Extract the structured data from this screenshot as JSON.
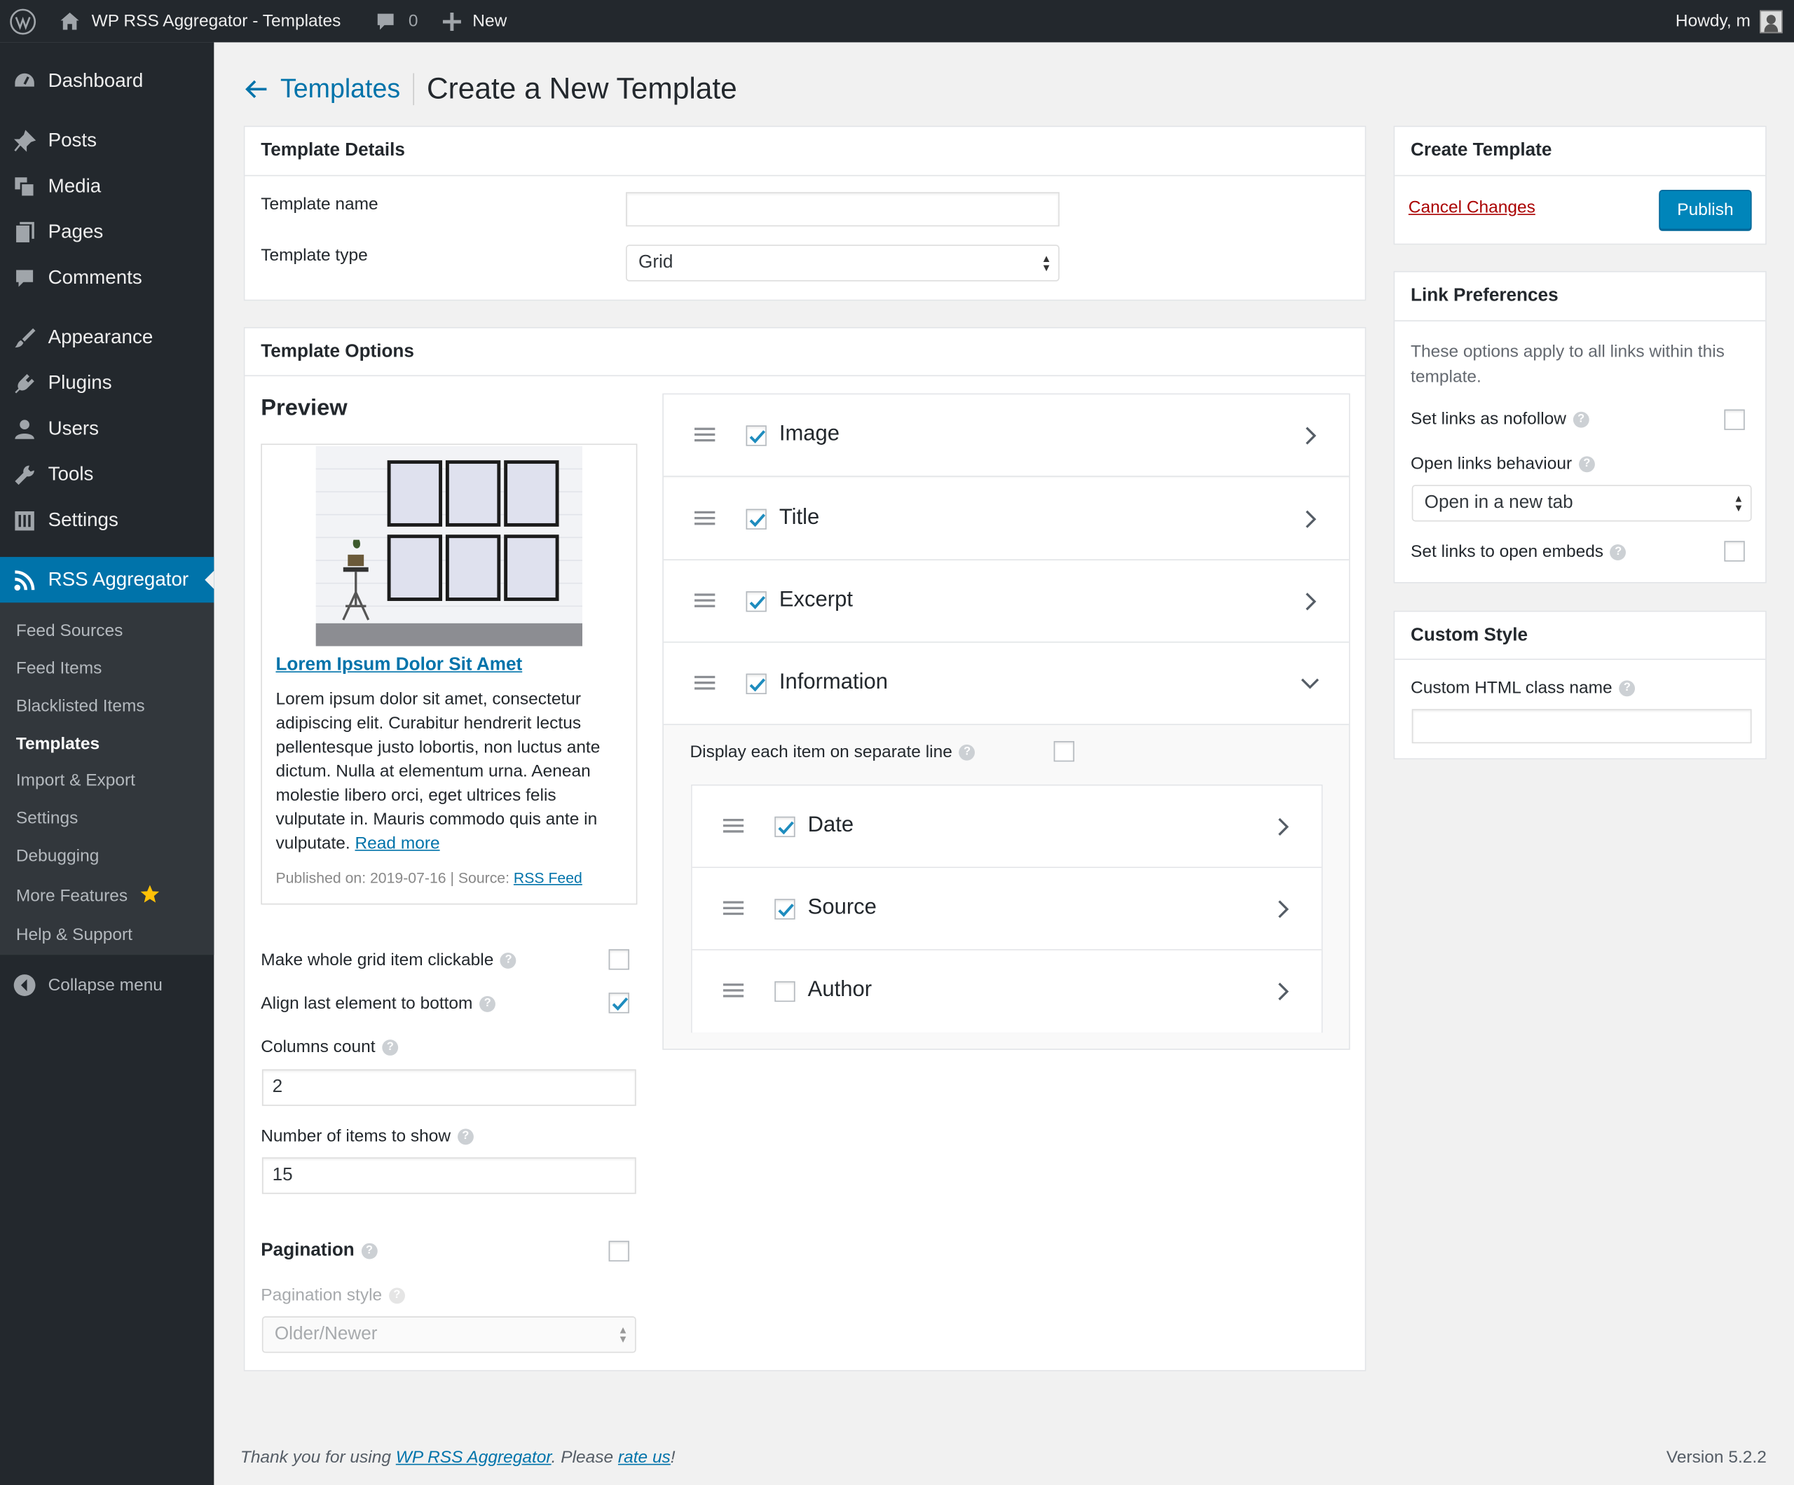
{
  "admin_bar": {
    "site_name": "WP RSS Aggregator - Templates",
    "comments_count": "0",
    "new_label": "New",
    "howdy": "Howdy, m"
  },
  "sidebar": {
    "menu": [
      {
        "label": "Dashboard",
        "icon": "dashboard-icon"
      },
      {
        "label": "Posts",
        "icon": "pin-icon"
      },
      {
        "label": "Media",
        "icon": "media-icon"
      },
      {
        "label": "Pages",
        "icon": "pages-icon"
      },
      {
        "label": "Comments",
        "icon": "comment-icon"
      },
      {
        "label": "Appearance",
        "icon": "brush-icon"
      },
      {
        "label": "Plugins",
        "icon": "plugin-icon"
      },
      {
        "label": "Users",
        "icon": "user-icon"
      },
      {
        "label": "Tools",
        "icon": "wrench-icon"
      },
      {
        "label": "Settings",
        "icon": "settings-icon"
      },
      {
        "label": "RSS Aggregator",
        "icon": "rss-icon"
      }
    ],
    "submenu": [
      "Feed Sources",
      "Feed Items",
      "Blacklisted Items",
      "Templates",
      "Import & Export",
      "Settings",
      "Debugging",
      "More Features",
      "Help & Support"
    ],
    "collapse_label": "Collapse menu"
  },
  "header": {
    "back_label": "Templates",
    "title": "Create a New Template"
  },
  "template_details": {
    "title": "Template Details",
    "name_label": "Template name",
    "name_value": "",
    "type_label": "Template type",
    "type_value": "Grid"
  },
  "template_options": {
    "title": "Template Options",
    "preview_title": "Preview",
    "preview": {
      "item_title": "Lorem Ipsum Dolor Sit Amet",
      "excerpt": "Lorem ipsum dolor sit amet, consectetur adipiscing elit. Curabitur hendrerit lectus pellentesque justo lobortis, non luctus ante dictum. Nulla at elementum urna. Aenean molestie libero orci, eget ultrices felis vulputate in. Mauris commodo quis ante in vulputate.",
      "read_more": "Read more",
      "meta_prefix": "Published on: 2019-07-16 | Source: ",
      "source_link": "RSS Feed"
    },
    "clickable_label": "Make whole grid item clickable",
    "clickable_checked": false,
    "align_label": "Align last element to bottom",
    "align_checked": true,
    "columns_label": "Columns count",
    "columns_value": "2",
    "items_label": "Number of items to show",
    "items_value": "15",
    "pagination_label": "Pagination",
    "pagination_checked": false,
    "pagination_style_label": "Pagination style",
    "pagination_style_value": "Older/Newer"
  },
  "fields": [
    {
      "name": "Image",
      "checked": true
    },
    {
      "name": "Title",
      "checked": true
    },
    {
      "name": "Excerpt",
      "checked": true
    },
    {
      "name": "Information",
      "checked": true,
      "expanded": true
    }
  ],
  "information": {
    "separate_line_label": "Display each item on separate line",
    "separate_line_checked": false,
    "subfields": [
      {
        "name": "Date",
        "checked": true
      },
      {
        "name": "Source",
        "checked": true
      },
      {
        "name": "Author",
        "checked": false
      }
    ]
  },
  "create_template": {
    "title": "Create Template",
    "cancel_label": "Cancel Changes",
    "publish_label": "Publish"
  },
  "link_prefs": {
    "title": "Link Preferences",
    "description": "These options apply to all links within this template.",
    "nofollow_label": "Set links as nofollow",
    "nofollow_checked": false,
    "behaviour_label": "Open links behaviour",
    "behaviour_value": "Open in a new tab",
    "embeds_label": "Set links to open embeds",
    "embeds_checked": false
  },
  "custom_style": {
    "title": "Custom Style",
    "class_label": "Custom HTML class name",
    "class_value": ""
  },
  "footer": {
    "thanks_prefix": "Thank you for using ",
    "plugin_link": "WP RSS Aggregator",
    "middle": ". Please ",
    "rate_link": "rate us",
    "suffix": "!",
    "version": "Version 5.2.2"
  },
  "colors": {
    "admin_dark": "#23282d",
    "accent": "#0073aa",
    "cancel_red": "#a00",
    "background": "#f1f1f1"
  }
}
